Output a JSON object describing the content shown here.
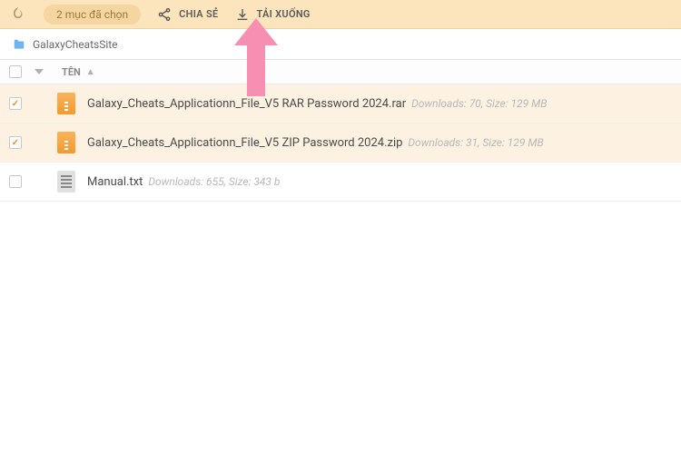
{
  "topbar": {
    "selection_text": "2 mục đã chọn",
    "share_label": "CHIA SẺ",
    "download_label": "TẢI XUỐNG"
  },
  "breadcrumb": {
    "path": "GalaxyCheatsSite"
  },
  "columns": {
    "name_label": "TÊN"
  },
  "files": [
    {
      "name": "Galaxy_Cheats_Applicationn_File_V5 RAR Password 2024.rar",
      "meta": "Downloads: 70, Size: 129 MB",
      "selected": true,
      "type": "archive"
    },
    {
      "name": "Galaxy_Cheats_Applicationn_File_V5 ZIP Password 2024.zip",
      "meta": "Downloads: 31, Size: 129 MB",
      "selected": true,
      "type": "archive"
    },
    {
      "name": "Manual.txt",
      "meta": "Downloads: 655, Size: 343 b",
      "selected": false,
      "type": "text"
    }
  ]
}
